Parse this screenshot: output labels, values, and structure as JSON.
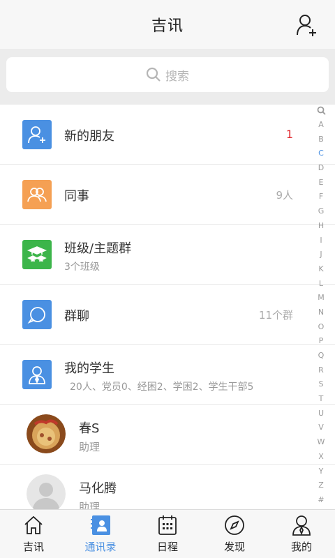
{
  "header": {
    "title": "吉讯",
    "add_icon": "add-contact-icon"
  },
  "search": {
    "placeholder": "搜索",
    "icon": "search-icon"
  },
  "list": {
    "new_friends": {
      "label": "新的朋友",
      "count": "1",
      "icon": "add-friend-icon",
      "color": "#4a90e2"
    },
    "colleagues": {
      "label": "同事",
      "count": "9人",
      "icon": "people-icon",
      "color": "#f5a053"
    },
    "class_groups": {
      "label": "班级/主题群",
      "sub": "3个班级",
      "icon": "graduates-icon",
      "color": "#3cb54a"
    },
    "group_chat": {
      "label": "群聊",
      "count": "11个群",
      "icon": "chat-bubble-icon",
      "color": "#4a90e2"
    },
    "my_students": {
      "label": "我的学生",
      "sub": "20人、党员0、经困2、学困2、学生干部5",
      "icon": "student-icon",
      "color": "#4a90e2"
    },
    "contacts": [
      {
        "name": "春S",
        "role": "助理"
      },
      {
        "name": "马化腾",
        "role": "助理"
      }
    ]
  },
  "index": {
    "letters": [
      "A",
      "B",
      "C",
      "D",
      "E",
      "F",
      "G",
      "H",
      "I",
      "J",
      "K",
      "L",
      "M",
      "N",
      "O",
      "P",
      "Q",
      "R",
      "S",
      "T",
      "U",
      "V",
      "W",
      "X",
      "Y",
      "Z",
      "#"
    ],
    "active": "C",
    "active_color": "#4a90e2"
  },
  "nav": {
    "tabs": [
      {
        "label": "吉讯",
        "icon": "home-icon"
      },
      {
        "label": "通讯录",
        "icon": "contacts-icon",
        "active": true
      },
      {
        "label": "日程",
        "icon": "calendar-icon"
      },
      {
        "label": "发现",
        "icon": "compass-icon"
      },
      {
        "label": "我的",
        "icon": "profile-icon"
      }
    ]
  }
}
